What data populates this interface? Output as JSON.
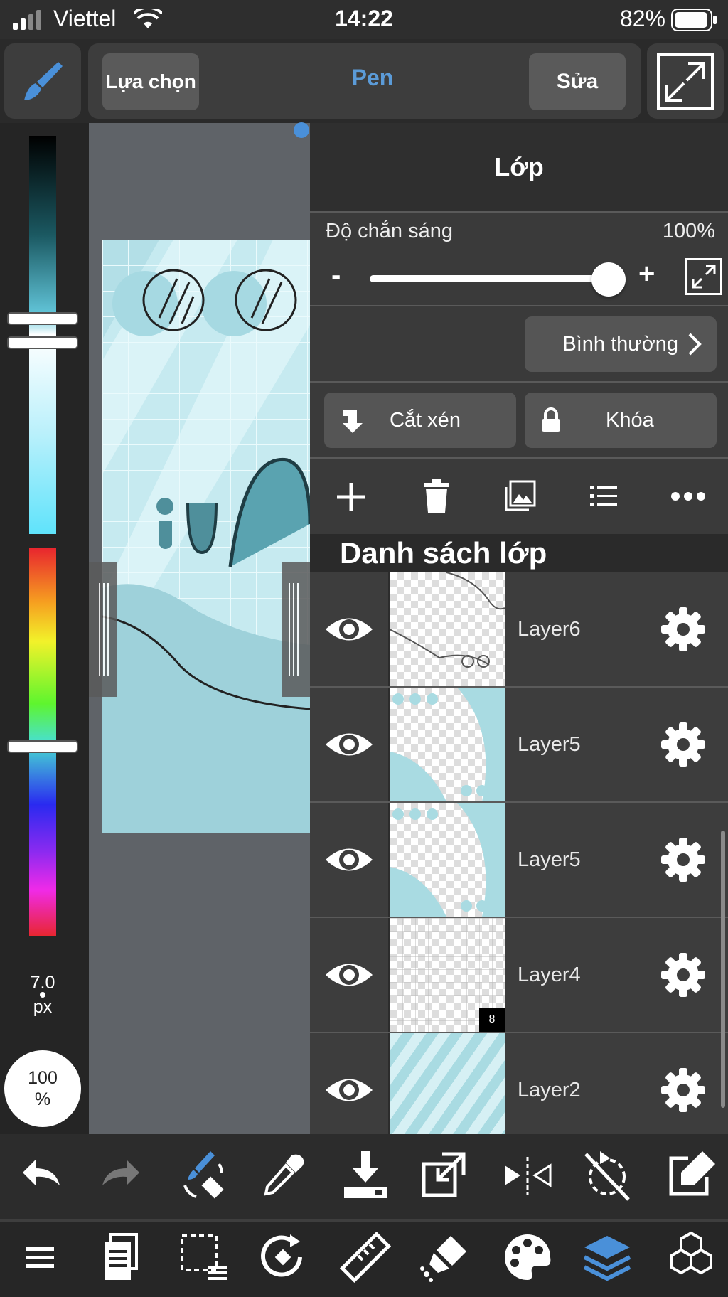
{
  "status_bar": {
    "carrier": "Viettel",
    "time": "14:22",
    "battery": "82%"
  },
  "top_toolbar": {
    "select_label": "Lựa chọn",
    "tool_name": "Pen",
    "edit_label": "Sửa"
  },
  "left_panel": {
    "brush_size": "7.0",
    "brush_size_unit": "px",
    "opacity_value": "100",
    "opacity_unit": "%"
  },
  "layer_panel": {
    "title": "Lớp",
    "opacity_label": "Độ chắn sáng",
    "opacity_value": "100%",
    "opacity_fraction": 1.0,
    "minus": "-",
    "plus": "+",
    "blend_mode": "Bình thường",
    "clip_label": "Cắt xén",
    "lock_label": "Khóa",
    "list_title": "Danh sách lớp",
    "layers": [
      {
        "name": "Layer6"
      },
      {
        "name": "Layer5"
      },
      {
        "name": "Layer5"
      },
      {
        "name": "Layer4",
        "badge": "8"
      },
      {
        "name": "Layer2"
      }
    ]
  },
  "colors": {
    "accent_blue": "#4a90d9",
    "canvas_teal": "#a9dbe2"
  }
}
